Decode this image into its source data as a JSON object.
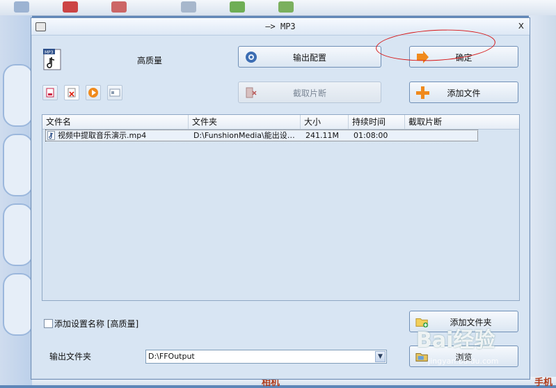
{
  "dialog": {
    "title": "—> MP3",
    "close_label": "x",
    "preset_name": "高质量",
    "buttons": {
      "output_config": "输出配置",
      "ok": "确定",
      "clip": "截取片断",
      "add_file": "添加文件",
      "add_folder": "添加文件夹",
      "browse": "浏览"
    },
    "table": {
      "headers": [
        "文件名",
        "文件夹",
        "大小",
        "持续时间",
        "截取片断"
      ],
      "rows": [
        {
          "name": "视频中提取音乐演示.mp4",
          "folder": "D:\\FunshionMedia\\能出设…",
          "size": "241.11M",
          "duration": "01:08:00",
          "clip": ""
        }
      ]
    },
    "add_setting_name_label": "添加设置名称 [高质量]",
    "output_folder_label": "输出文件夹",
    "output_folder_value": "D:\\FFOutput"
  },
  "background": {
    "bottom_text_left": "相机",
    "bottom_text_right": "手机"
  },
  "watermark": {
    "brand": "Bai经验",
    "url": "jingyan.baidu.com"
  },
  "colors": {
    "accent": "#f08a1c",
    "annotation": "#d61414",
    "dialog_bg": "#d8e5f3"
  }
}
